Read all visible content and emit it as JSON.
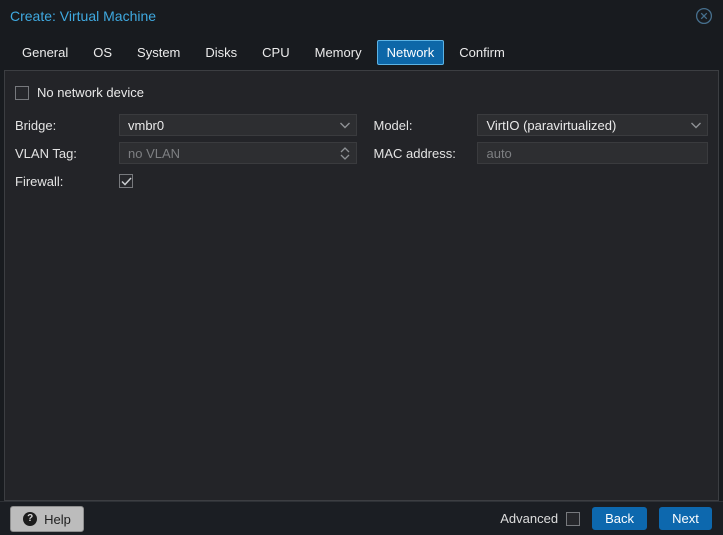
{
  "window": {
    "title": "Create: Virtual Machine"
  },
  "icons": {
    "close": "circle-x",
    "help_glyph": "?",
    "dropdown": "chevron-down",
    "spinner": "chevron-up-down",
    "firewall_check": "checkmark"
  },
  "tabs": [
    {
      "label": "General",
      "active": false
    },
    {
      "label": "OS",
      "active": false
    },
    {
      "label": "System",
      "active": false
    },
    {
      "label": "Disks",
      "active": false
    },
    {
      "label": "CPU",
      "active": false
    },
    {
      "label": "Memory",
      "active": false
    },
    {
      "label": "Network",
      "active": true
    },
    {
      "label": "Confirm",
      "active": false
    }
  ],
  "panel": {
    "no_network_device": {
      "label": "No network device",
      "checked": false
    },
    "bridge": {
      "label": "Bridge:",
      "value": "vmbr0",
      "control": "combobox"
    },
    "vlan_tag": {
      "label": "VLAN Tag:",
      "value": "no VLAN",
      "control": "number-spinner",
      "disabled": true
    },
    "firewall": {
      "label": "Firewall:",
      "checked": true,
      "control": "checkbox"
    },
    "model": {
      "label": "Model:",
      "value": "VirtIO (paravirtualized)",
      "control": "combobox"
    },
    "mac_address": {
      "label": "MAC address:",
      "value": "",
      "placeholder": "auto",
      "control": "textbox"
    }
  },
  "footer": {
    "help_label": "Help",
    "advanced_label": "Advanced",
    "advanced_checked": false,
    "back_label": "Back",
    "next_label": "Next"
  },
  "colors": {
    "title_blue": "#3fa9e0",
    "accent_blue": "#0d68ae",
    "active_tab_border": "#5cb3e4",
    "panel_bg": "#232428",
    "field_bg": "#2d2e31",
    "placeholder_gray": "#7d7f82"
  }
}
